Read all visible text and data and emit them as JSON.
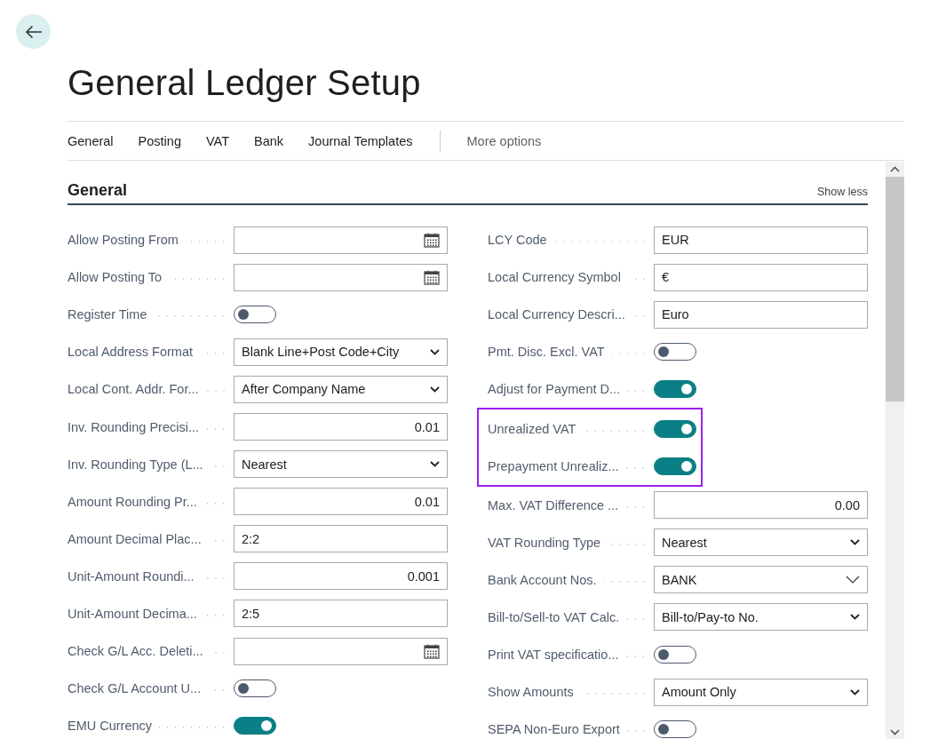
{
  "page": {
    "title": "General Ledger Setup"
  },
  "tabs": [
    {
      "label": "General",
      "kind": "tab"
    },
    {
      "label": "Posting",
      "kind": "tab"
    },
    {
      "label": "VAT",
      "kind": "tab"
    },
    {
      "label": "Bank",
      "kind": "tab"
    },
    {
      "label": "Journal Templates",
      "kind": "tab"
    },
    {
      "label": "More options",
      "kind": "more"
    }
  ],
  "section": {
    "title": "General",
    "toggle_label": "Show less"
  },
  "left_fields": [
    {
      "label": "Allow Posting From",
      "kind": "date",
      "highlighted": false
    },
    {
      "label": "Allow Posting To",
      "kind": "date",
      "highlighted": false
    },
    {
      "label": "Register Time",
      "kind": "toggle",
      "on": false,
      "highlighted": false
    },
    {
      "label": "Local Address Format",
      "kind": "select",
      "value": "Blank Line+Post Code+City",
      "highlighted": false
    },
    {
      "label": "Local Cont. Addr. For...",
      "kind": "select",
      "value": "After Company Name",
      "highlighted": false
    },
    {
      "label": "Inv. Rounding Precisi...",
      "kind": "number",
      "value": "0.01",
      "highlighted": false
    },
    {
      "label": "Inv. Rounding Type (L...",
      "kind": "select",
      "value": "Nearest",
      "highlighted": false
    },
    {
      "label": "Amount Rounding Pr...",
      "kind": "number",
      "value": "0.01",
      "highlighted": false
    },
    {
      "label": "Amount Decimal Plac...",
      "kind": "text",
      "value": "2:2",
      "highlighted": false
    },
    {
      "label": "Unit-Amount Roundi...",
      "kind": "number",
      "value": "0.001",
      "highlighted": false
    },
    {
      "label": "Unit-Amount Decima...",
      "kind": "text",
      "value": "2:5",
      "highlighted": false
    },
    {
      "label": "Check G/L Acc. Deleti...",
      "kind": "date",
      "highlighted": false
    },
    {
      "label": "Check G/L Account U...",
      "kind": "toggle",
      "on": false,
      "highlighted": false
    },
    {
      "label": "EMU Currency",
      "kind": "toggle",
      "on": true,
      "highlighted": false
    }
  ],
  "right_fields": [
    {
      "label": "LCY Code",
      "kind": "text",
      "value": "EUR",
      "highlighted": false
    },
    {
      "label": "Local Currency Symbol",
      "kind": "text",
      "value": "€",
      "highlighted": false
    },
    {
      "label": "Local Currency Descri...",
      "kind": "text",
      "value": "Euro",
      "highlighted": false
    },
    {
      "label": "Pmt. Disc. Excl. VAT",
      "kind": "toggle",
      "on": false,
      "highlighted": false
    },
    {
      "label": "Adjust for Payment D...",
      "kind": "toggle",
      "on": true,
      "highlighted": false
    },
    {
      "label": "Unrealized VAT",
      "kind": "toggle",
      "on": true,
      "highlighted": true
    },
    {
      "label": "Prepayment Unrealiz...",
      "kind": "toggle",
      "on": true,
      "highlighted": true
    },
    {
      "label": "Max. VAT Difference ...",
      "kind": "number",
      "value": "0.00",
      "highlighted": false
    },
    {
      "label": "VAT Rounding Type",
      "kind": "select",
      "value": "Nearest",
      "highlighted": false
    },
    {
      "label": "Bank Account Nos.",
      "kind": "lookup",
      "value": "BANK",
      "highlighted": false
    },
    {
      "label": "Bill-to/Sell-to VAT Calc.",
      "kind": "select",
      "value": "Bill-to/Pay-to No.",
      "highlighted": false
    },
    {
      "label": "Print VAT specificatio...",
      "kind": "toggle",
      "on": false,
      "highlighted": false
    },
    {
      "label": "Show Amounts",
      "kind": "select",
      "value": "Amount Only",
      "highlighted": false
    },
    {
      "label": "SEPA Non-Euro Export",
      "kind": "toggle",
      "on": false,
      "highlighted": false
    }
  ]
}
